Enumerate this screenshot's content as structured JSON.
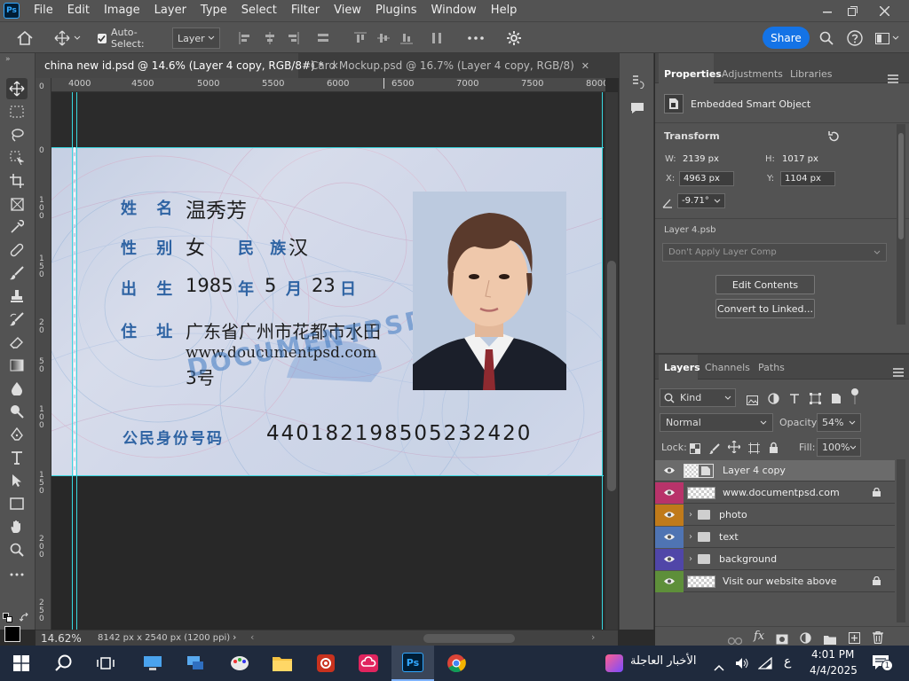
{
  "app": {
    "logo": "Ps"
  },
  "menu": [
    "File",
    "Edit",
    "Image",
    "Layer",
    "Type",
    "Select",
    "Filter",
    "View",
    "Plugins",
    "Window",
    "Help"
  ],
  "options": {
    "auto_select_label": "Auto-Select:",
    "auto_select_value": "Layer",
    "share_label": "Share"
  },
  "tabs": [
    {
      "label": "china new id.psd @ 14.6% (Layer 4 copy, RGB/8#) *",
      "active": true
    },
    {
      "label": "Card Mockup.psd @ 16.7% (Layer 4 copy, RGB/8)",
      "active": false
    }
  ],
  "ruler": {
    "top": [
      "4000",
      "4500",
      "5000",
      "5500",
      "6000",
      "6500",
      "7000",
      "7500",
      "8000"
    ],
    "left": [
      "0",
      "0",
      "1 0 0",
      "1 5 0",
      "2 0",
      "5 0",
      "1 0 0",
      "1 5 0",
      "2 0 0",
      "2 5 0"
    ]
  },
  "card": {
    "name_label": "姓 名",
    "name_value": "温秀芳",
    "sex_label": "性 别",
    "sex_value": "女",
    "ethnicity_label": "民 族",
    "ethnicity_value": "汉",
    "birth_label": "出 生",
    "birth_year": "1985",
    "year_char": "年",
    "birth_month": "5",
    "month_char": "月",
    "birth_day": "23",
    "day_char": "日",
    "address_label": "住 址",
    "address_line1": "广东省广州市花都市水田",
    "address_line2": "www.doucumentpsd.com",
    "address_line3": "3号",
    "id_label": "公民身份号码",
    "id_number": "440182198505232420",
    "watermark": "DOCUMENTPSD.COM"
  },
  "properties": {
    "tabs": [
      "Properties",
      "Adjustments",
      "Libraries"
    ],
    "object_type": "Embedded Smart Object",
    "transform_title": "Transform",
    "w_label": "W:",
    "w_value": "2139 px",
    "h_label": "H:",
    "h_value": "1017 px",
    "x_label": "X:",
    "x_value": "4963 px",
    "y_label": "Y:",
    "y_value": "1104 px",
    "angle_value": "-9.71°",
    "file_name": "Layer 4.psb",
    "layer_comp": "Don't Apply Layer Comp",
    "edit_contents": "Edit Contents",
    "convert_linked": "Convert to Linked..."
  },
  "layers_panel": {
    "tabs": [
      "Layers",
      "Channels",
      "Paths"
    ],
    "filter_kind": "Kind",
    "blend_mode": "Normal",
    "opacity_label": "Opacity:",
    "opacity_value": "54%",
    "lock_label": "Lock:",
    "fill_label": "Fill:",
    "fill_value": "100%",
    "rows": [
      {
        "name": "Layer 4 copy",
        "color": "#535353",
        "type": "smart",
        "selected": true,
        "locked": false
      },
      {
        "name": "www.documentpsd.com",
        "color": "#b8336a",
        "type": "checker",
        "selected": false,
        "locked": true
      },
      {
        "name": "photo",
        "color": "#c07a1a",
        "type": "folder",
        "selected": false,
        "locked": false
      },
      {
        "name": "text",
        "color": "#4f74b3",
        "type": "folder",
        "selected": false,
        "locked": false
      },
      {
        "name": "background",
        "color": "#5046a8",
        "type": "folder",
        "selected": false,
        "locked": false
      },
      {
        "name": "Visit our website above",
        "color": "#5e8f3a",
        "type": "checker",
        "selected": false,
        "locked": true
      }
    ]
  },
  "status": {
    "zoom": "14.62%",
    "doc_info": "8142 px x 2540 px (1200 ppi)"
  },
  "taskbar": {
    "news_label": "الأخبار العاجلة",
    "lang": "ع",
    "time": "4:01 PM",
    "date": "4/4/2025",
    "notification_count": "1"
  },
  "colors": {
    "accent": "#1473e6",
    "guide": "#38d8e0",
    "card_label": "#2e63a3"
  }
}
